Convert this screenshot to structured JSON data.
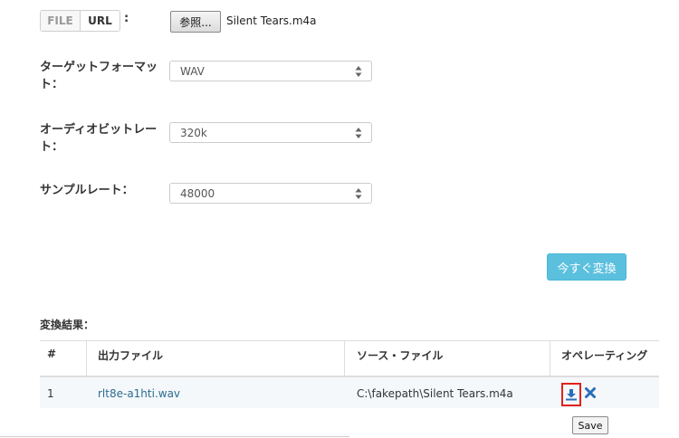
{
  "source": {
    "file_tab": "FILE",
    "url_tab": "URL",
    "colon": ":",
    "browse_label": "参照...",
    "filename": "Silent Tears.m4a"
  },
  "settings": {
    "target_format": {
      "label": "ターゲットフォーマット：",
      "value": "WAV"
    },
    "audio_bitrate": {
      "label": "オーディオビットレート：",
      "value": "320k"
    },
    "sample_rate": {
      "label": "サンプルレート：",
      "value": "48000"
    }
  },
  "convert_button": "今すぐ変換",
  "results": {
    "title": "変換結果：",
    "columns": [
      "#",
      "出力ファイル",
      "ソース・ファイル",
      "オペレーティング"
    ],
    "rows": [
      {
        "index": "1",
        "output": "rlt8e-a1hti.wav",
        "source": "C:\\fakepath\\Silent Tears.m4a"
      }
    ]
  },
  "save_label": "Save",
  "icons": {
    "download": "download-icon",
    "delete": "close-icon",
    "select_arrows": "chevron-up-down-icon"
  },
  "colors": {
    "accent": "#5bc0de",
    "link": "#2a6d8f",
    "delete": "#2a6ebb",
    "highlight": "#e0221b"
  }
}
